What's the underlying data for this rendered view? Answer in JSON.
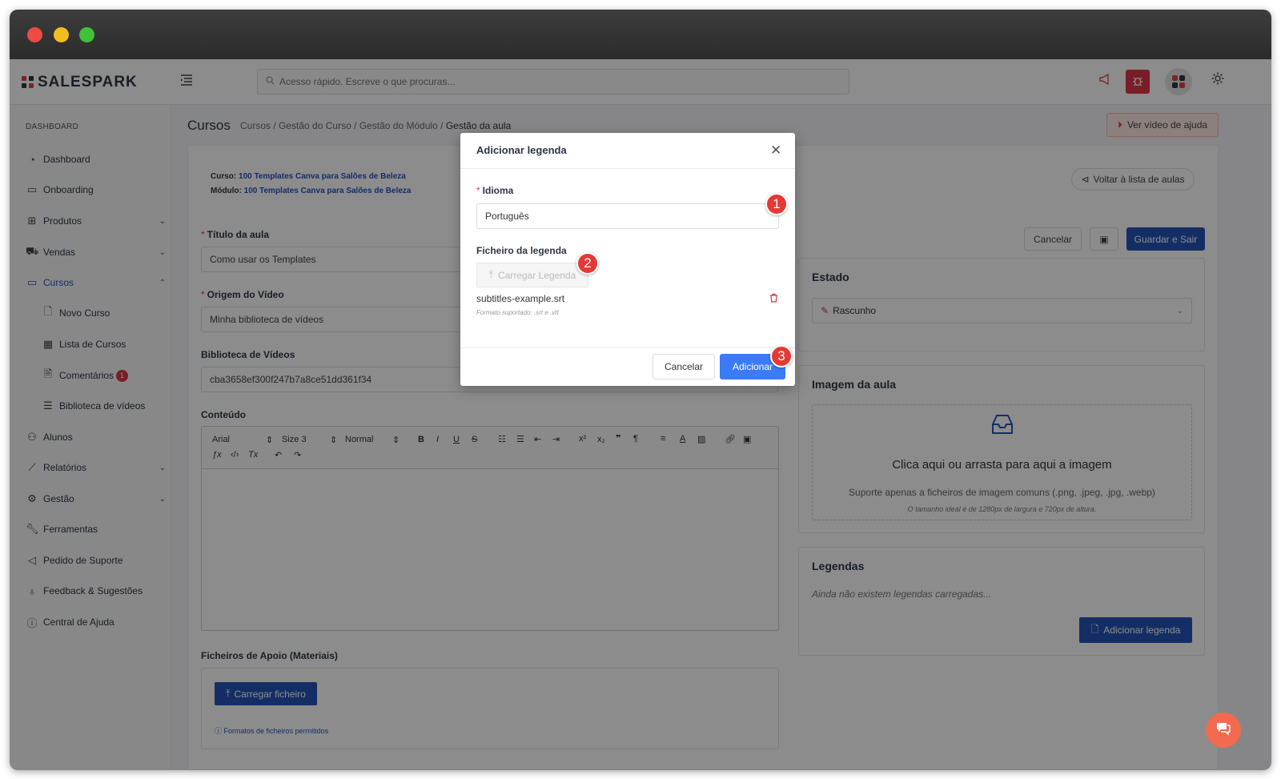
{
  "app": {
    "brand": "SALESPARK",
    "search_placeholder": "Acesso rápido. Escreve o que procuras..."
  },
  "sidebar": {
    "section": "DASHBOARD",
    "items": [
      {
        "label": "Dashboard"
      },
      {
        "label": "Onboarding"
      },
      {
        "label": "Produtos"
      },
      {
        "label": "Vendas"
      },
      {
        "label": "Cursos"
      },
      {
        "label": "Novo Curso"
      },
      {
        "label": "Lista de Cursos"
      },
      {
        "label": "Comentários",
        "badge": "1"
      },
      {
        "label": "Biblioteca de vídeos"
      },
      {
        "label": "Alunos"
      },
      {
        "label": "Relatórios"
      },
      {
        "label": "Gestão"
      },
      {
        "label": "Ferramentas"
      },
      {
        "label": "Pedido de Suporte"
      },
      {
        "label": "Feedback & Sugestões"
      },
      {
        "label": "Central de Ajuda"
      }
    ]
  },
  "header": {
    "title": "Cursos",
    "breadcrumb": [
      "Cursos",
      "Gestão do Curso",
      "Gestão do Módulo",
      "Gestão da aula"
    ],
    "help_video": "Ver vídeo de ajuda"
  },
  "course_info": {
    "course_label": "Curso:",
    "course_value": "100 Templates Canva para Salões de Beleza",
    "module_label": "Módulo:",
    "module_value": "100 Templates Canva para Salões de Beleza"
  },
  "actions": {
    "back": "Voltar à lista de aulas",
    "cancel": "Cancelar",
    "save_exit": "Guardar e Sair"
  },
  "form": {
    "title_label": "Título da aula",
    "title_value": "Como usar os Templates",
    "origin_label": "Origem do Vídeo",
    "origin_value": "Minha biblioteca de vídeos",
    "library_label": "Biblioteca de Vídeos",
    "library_value": "cba3658ef300f247b7a8ce51dd361f34",
    "content_label": "Conteúdo",
    "editor": {
      "font": "Arial",
      "size": "Size 3",
      "format": "Normal"
    },
    "files_label": "Ficheiros de Apoio (Materiais)",
    "upload_file": "Carregar ficheiro",
    "allowed_formats": "Formatos de ficheiros permitidos"
  },
  "state_panel": {
    "title": "Estado",
    "value": "Rascunho"
  },
  "image_panel": {
    "title": "Imagem da aula",
    "dz_title": "Clica aqui ou arrasta para aqui a imagem",
    "dz_sub": "Suporte apenas a ficheiros de imagem comuns (.png, .jpeg, .jpg, .webp)",
    "dz_hint": "O tamanho ideal é de 1280px de largura e 720px de altura."
  },
  "subtitles_panel": {
    "title": "Legendas",
    "empty": "Ainda não existem legendas carregadas...",
    "add": "Adicionar legenda"
  },
  "modal": {
    "title": "Adicionar legenda",
    "language_label": "Idioma",
    "language_value": "Português",
    "file_label": "Ficheiro da legenda",
    "upload": "Carregar Legenda",
    "file_name": "subtitles-example.srt",
    "formats": "Formato suportado: .srt e .vtt",
    "cancel": "Cancelar",
    "add": "Adicionar"
  },
  "steps": [
    "1",
    "2",
    "3"
  ],
  "colors": {
    "primary": "#2554b8",
    "accent_blue": "#3a7cf6",
    "danger": "#dc3545",
    "brand_red": "#e2463c"
  }
}
